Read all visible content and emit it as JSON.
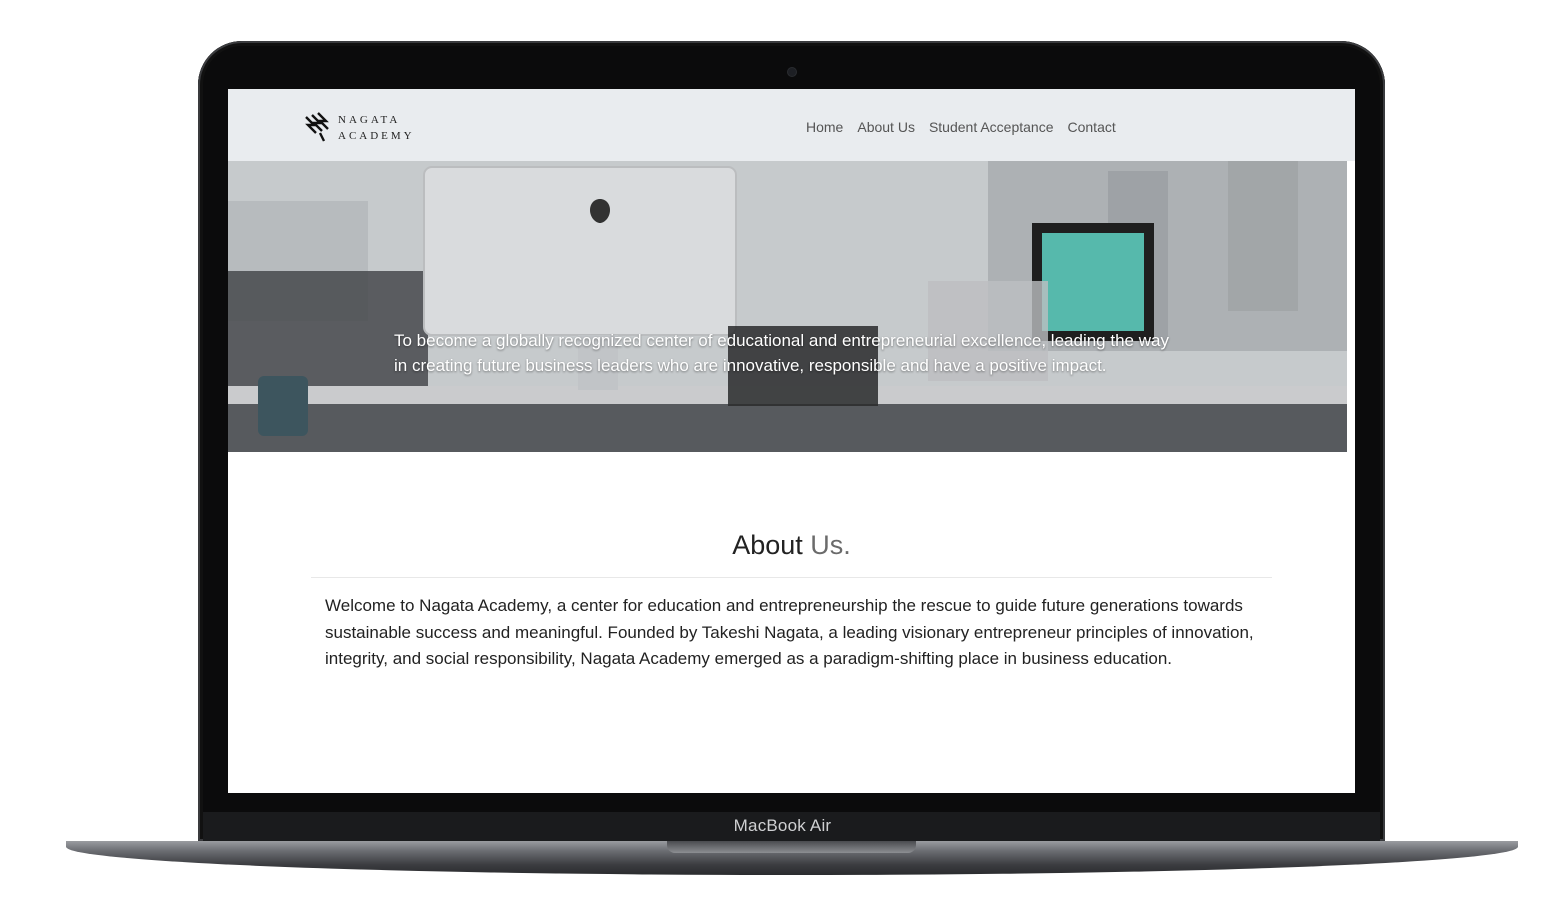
{
  "device": {
    "label": "MacBook Air"
  },
  "site": {
    "logo": {
      "line1": "NAGATA",
      "line2": "ACADEMY"
    },
    "nav": {
      "items": [
        "Home",
        "About Us",
        "Student Acceptance",
        "Contact"
      ]
    },
    "hero": {
      "text": "To become a globally recognized center of educational and entrepreneurial excellence, leading the way in creating future business leaders who are innovative, responsible and have a positive impact."
    },
    "about": {
      "title_main": "About",
      "title_accent": "Us.",
      "body": "Welcome to Nagata Academy, a center for education and entrepreneurship the rescue to guide future generations towards sustainable success and meaningful. Founded by Takeshi Nagata, a leading visionary entrepreneur principles of innovation, integrity, and social responsibility, Nagata Academy emerged as a paradigm-shifting place in business education."
    }
  },
  "colors": {
    "nav_bg": "#e9ecef",
    "text": "#222222",
    "accent": "#6b6b6b"
  }
}
